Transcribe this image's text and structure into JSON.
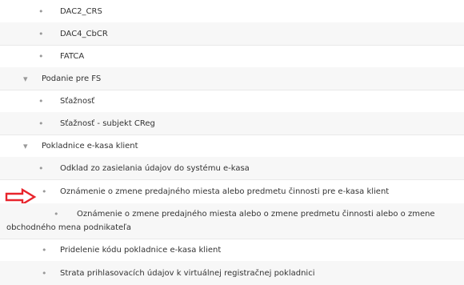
{
  "tree": {
    "items": [
      {
        "label": "DAC2_CRS",
        "bullet": "•",
        "level": 2
      },
      {
        "label": "DAC4_CbCR",
        "bullet": "•",
        "level": 2
      },
      {
        "label": "FATCA",
        "bullet": "•",
        "level": 2
      },
      {
        "label": "Podanie pre FS",
        "bullet": "▾",
        "level": 1
      },
      {
        "label": "Sťažnosť",
        "bullet": "•",
        "level": 2
      },
      {
        "label": "Sťažnosť - subjekt CReg",
        "bullet": "•",
        "level": 2
      },
      {
        "label": "Pokladnice e-kasa klient",
        "bullet": "▾",
        "level": 1
      },
      {
        "label": "Odklad zo zasielania údajov do systému e-kasa",
        "bullet": "•",
        "level": 2
      },
      {
        "label": "Oznámenie o zmene predajného miesta alebo predmetu činnosti pre e-kasa klient",
        "bullet": "•",
        "level": 2
      },
      {
        "label": "Oznámenie o zmene predajného miesta alebo o zmene predmetu činnosti alebo o zmene obchodného mena podnikateľa",
        "bullet": "•",
        "level": 2
      },
      {
        "label": "Pridelenie kódu pokladnice e-kasa klient",
        "bullet": "•",
        "level": 2
      },
      {
        "label": "Strata prihlasovacích údajov k virtuálnej registračnej pokladnici",
        "bullet": "•",
        "level": 2
      }
    ]
  },
  "annotations": {
    "arrow_icon": "arrow-right-outline-icon",
    "highlight_color": "#e8242c"
  }
}
